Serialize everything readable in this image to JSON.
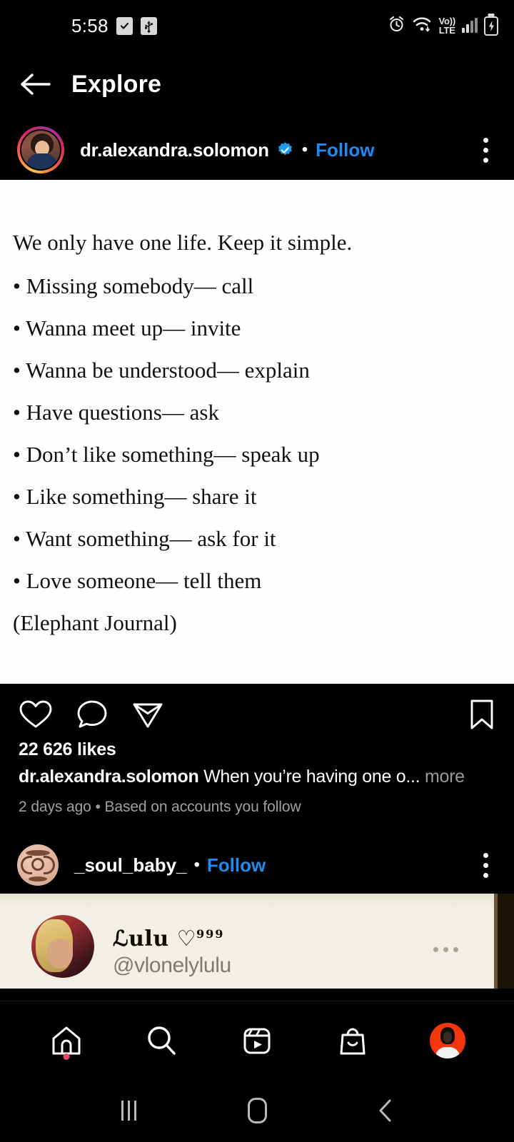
{
  "status_bar": {
    "time": "5:58",
    "left_icons": [
      "checkbox-checked-icon",
      "usb-icon"
    ],
    "right_icons": [
      "alarm-icon",
      "wifi-icon",
      "volte-icon",
      "signal-bars-icon",
      "battery-charging-icon"
    ],
    "network_label_top": "Vo))",
    "network_label_bottom": "LTE"
  },
  "header": {
    "back_icon": "back-arrow-icon",
    "title": "Explore"
  },
  "post": {
    "username": "dr.alexandra.solomon",
    "verified": true,
    "separator": "•",
    "follow_label": "Follow",
    "menu_icon": "kebab-menu-icon",
    "image_lines": [
      "We only have one life. Keep it simple.",
      "• Missing somebody— call",
      "• Wanna meet up— invite",
      "• Wanna be understood— explain",
      "• Have questions— ask",
      "• Don’t like something— speak up",
      "• Like something— share it",
      "• Want something— ask for it",
      "• Love someone— tell them",
      "(Elephant Journal)"
    ],
    "actions": {
      "like_icon": "heart-icon",
      "comment_icon": "comment-icon",
      "share_icon": "share-paper-plane-icon",
      "save_icon": "bookmark-icon"
    },
    "likes": "22 626 likes",
    "caption_user": "dr.alexandra.solomon",
    "caption_text": "When you’re having one o...",
    "caption_more": "more",
    "timestamp": "2 days ago • Based on accounts you follow"
  },
  "post2": {
    "username": "_soul_baby_",
    "separator": "•",
    "follow_label": "Follow",
    "menu_icon": "kebab-menu-icon",
    "tweet": {
      "display_name": "ℒulu ♡",
      "superscript": "999",
      "handle": "@vlonelylulu",
      "menu_icon": "more-horizontal-icon"
    }
  },
  "bottom_nav": {
    "items": [
      {
        "name": "home",
        "icon": "home-icon",
        "badge": true
      },
      {
        "name": "search",
        "icon": "search-icon",
        "badge": false
      },
      {
        "name": "reels",
        "icon": "reels-icon",
        "badge": false
      },
      {
        "name": "shop",
        "icon": "shop-bag-icon",
        "badge": false
      },
      {
        "name": "profile",
        "icon": "profile-avatar-icon",
        "badge": false
      }
    ]
  },
  "android_nav": {
    "recents_icon": "recents-icon",
    "home_icon": "home-pill-icon",
    "back_icon": "back-chevron-icon"
  },
  "colors": {
    "background": "#000000",
    "link_blue": "#1e8bf0",
    "verified_blue": "#1c9cf0",
    "post_card": "#fefefe",
    "muted_text": "#a0a0a0",
    "tweet_card": "#f3efe4",
    "badge_red": "#e8485f",
    "profile_orange": "#f5360c"
  }
}
